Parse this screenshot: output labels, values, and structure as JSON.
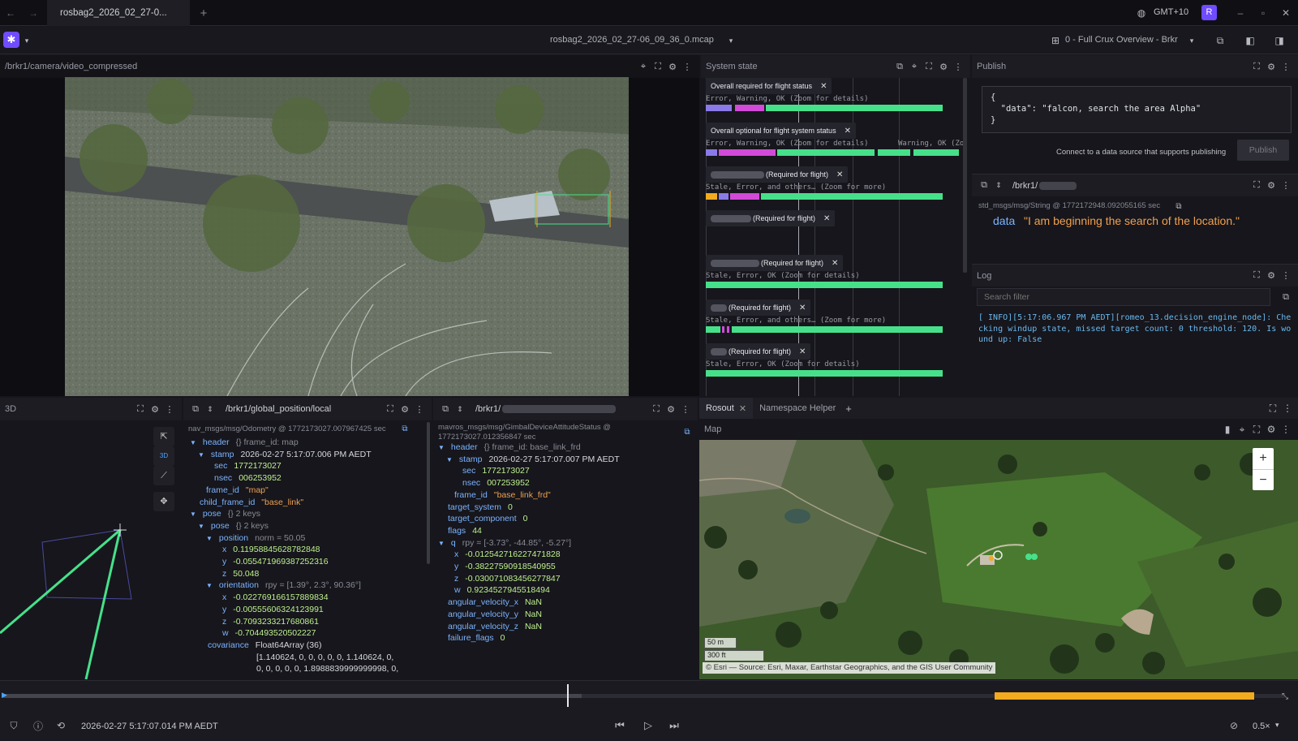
{
  "tab": {
    "title": "rosbag2_2026_02_27-0...",
    "plus": "+"
  },
  "topbar": {
    "timezone": "GMT+10",
    "avatar": "R"
  },
  "toolbar": {
    "file": "rosbag2_2026_02_27-06_09_36_0.mcap",
    "layout": "0 - Full Crux Overview - Brkr"
  },
  "video": {
    "topic": "/brkr1/camera/video_compressed"
  },
  "system": {
    "title": "System state",
    "rows": [
      {
        "chip": "Overall required for flight status",
        "label": "Error, Warning, OK (Zoom for details)"
      },
      {
        "chip": "Overall optional for flight system status",
        "label": "Error, Warning, OK (Zoom for details)",
        "label2": "Warning, OK (Zo"
      },
      {
        "chip": "(Required for flight)",
        "label": "Stale, Error, and others… (Zoom for more)"
      },
      {
        "chip": "(Required for flight)",
        "label": ""
      },
      {
        "chip": "(Required for flight)",
        "label": "Stale, Error, OK (Zoom for details)"
      },
      {
        "chip": "(Required for flight)",
        "label": "Stale, Error, and others… (Zoom for more)"
      },
      {
        "chip": "(Required for flight)",
        "label": "Stale, Error, OK (Zoom for details)"
      }
    ]
  },
  "publish": {
    "title": "Publish",
    "json_lines": [
      "{",
      "  \"data\": \"falcon, search the area Alpha\"",
      "}"
    ],
    "hint": "Connect to a data source that supports publishing",
    "button": "Publish"
  },
  "raw": {
    "topic": "/brkr1/",
    "meta": "std_msgs/msg/String @ 1772172948.092055165 sec",
    "key": "data",
    "value": "\"I am beginning the search of the location.\""
  },
  "log": {
    "title": "Log",
    "placeholder": "Search filter",
    "text": "[ INFO][5:17:06.967 PM AEDT][romeo_13.decision_engine_node]: Checking windup state, missed target count: 0 threshold: 120. Is wound up: False"
  },
  "threed": {
    "title": "3D",
    "btn3d": "3D"
  },
  "odom": {
    "topic": "/brkr1/global_position/local",
    "meta": "nav_msgs/msg/Odometry @ 1772173027.007967425 sec",
    "lines": [
      {
        "i": 8,
        "a": "▼",
        "k": "header",
        "g": "{} frame_id: map"
      },
      {
        "i": 18,
        "a": "▼",
        "k": "stamp",
        "w": "2026-02-27 5:17:07.006 PM AEDT"
      },
      {
        "i": 38,
        "k": "sec",
        "v": "1772173027"
      },
      {
        "i": 38,
        "k": "nsec",
        "v": "006253952"
      },
      {
        "i": 28,
        "k": "frame_id",
        "s": "\"map\""
      },
      {
        "i": 20,
        "k": "child_frame_id",
        "s": "\"base_link\""
      },
      {
        "i": 8,
        "a": "▼",
        "k": "pose",
        "g": "{} 2 keys"
      },
      {
        "i": 18,
        "a": "▼",
        "k": "pose",
        "g": "{} 2 keys"
      },
      {
        "i": 28,
        "a": "▼",
        "k": "position",
        "g": "norm = 50.05"
      },
      {
        "i": 48,
        "k": "x",
        "v": "0.11958845628782848"
      },
      {
        "i": 48,
        "k": "y",
        "v": "-0.055471969387252316"
      },
      {
        "i": 48,
        "k": "z",
        "v": "50.048"
      },
      {
        "i": 28,
        "a": "▼",
        "k": "orientation",
        "g": "rpy = [1.39°, 2.3°, 90.36°]"
      },
      {
        "i": 48,
        "k": "x",
        "v": "-0.022769166157889834"
      },
      {
        "i": 48,
        "k": "y",
        "v": "-0.00555606324123991"
      },
      {
        "i": 48,
        "k": "z",
        "v": "-0.7093233217680861"
      },
      {
        "i": 48,
        "k": "w",
        "v": "-0.704493520502227"
      },
      {
        "i": 30,
        "k": "covariance",
        "w": "Float64Array (36)"
      },
      {
        "i": 90,
        "w": "[1.140624, 0, 0, 0, 0, 0, 1.140624, 0,"
      },
      {
        "i": 90,
        "w": "0, 0, 0, 0, 0, 1.8988839999999998, 0,"
      }
    ]
  },
  "gimbal": {
    "topic": "/brkr1/",
    "meta": "mavros_msgs/msg/GimbalDeviceAttitudeStatus @",
    "meta2": "1772173027.012356847 sec",
    "lines": [
      {
        "i": 6,
        "a": "▼",
        "k": "header",
        "g": "{} frame_id: base_link_frd"
      },
      {
        "i": 16,
        "a": "▼",
        "k": "stamp",
        "w": "2026-02-27 5:17:07.007 PM AEDT"
      },
      {
        "i": 36,
        "k": "sec",
        "v": "1772173027"
      },
      {
        "i": 36,
        "k": "nsec",
        "v": "007253952"
      },
      {
        "i": 26,
        "k": "frame_id",
        "s": "\"base_link_frd\""
      },
      {
        "i": 18,
        "k": "target_system",
        "v": "0"
      },
      {
        "i": 18,
        "k": "target_component",
        "v": "0"
      },
      {
        "i": 18,
        "k": "flags",
        "v": "44"
      },
      {
        "i": 6,
        "a": "▼",
        "k": "q",
        "g": "rpy = [-3.73°, -44.85°, -5.27°]"
      },
      {
        "i": 26,
        "k": "x",
        "v": "-0.012542716227471828"
      },
      {
        "i": 26,
        "k": "y",
        "v": "-0.38227590918540955"
      },
      {
        "i": 26,
        "k": "z",
        "v": "-0.030071083456277847"
      },
      {
        "i": 26,
        "k": "w",
        "v": "0.9234527945518494"
      },
      {
        "i": 18,
        "k": "angular_velocity_x",
        "v": "NaN"
      },
      {
        "i": 18,
        "k": "angular_velocity_y",
        "v": "NaN"
      },
      {
        "i": 18,
        "k": "angular_velocity_z",
        "v": "NaN"
      },
      {
        "i": 18,
        "k": "failure_flags",
        "v": "0"
      }
    ]
  },
  "maptabs": {
    "t1": "Rosout",
    "t2": "Namespace Helper",
    "add": "+"
  },
  "map": {
    "title": "Map",
    "scale_m": "50 m",
    "scale_ft": "300 ft",
    "attribution": "© Esri — Source: Esri, Maxar, Earthstar Geographics, and the GIS User Community",
    "zoom_in": "+",
    "zoom_out": "−"
  },
  "playback": {
    "time": "2026-02-27 5:17:07.014 PM AEDT",
    "speed": "0.5×",
    "progress": 0.44
  },
  "colors": {
    "accent": "#6f4cff",
    "green": "#47e08a",
    "orange": "#f2aa1f",
    "magenta": "#d24ad8"
  }
}
